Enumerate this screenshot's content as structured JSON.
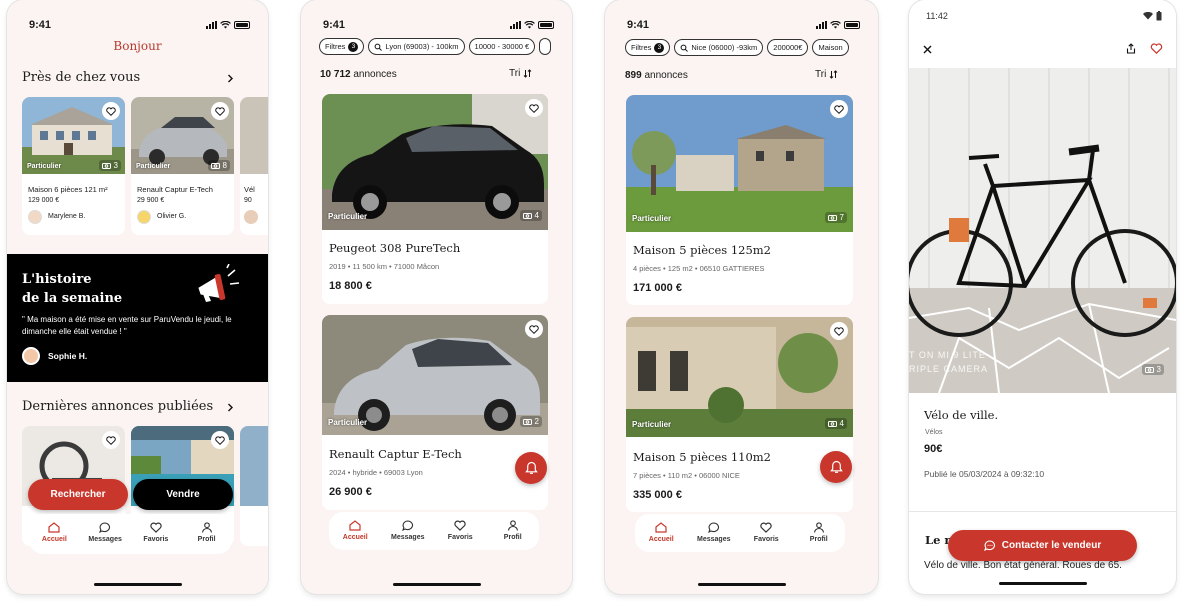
{
  "colors": {
    "accent": "#c9372c",
    "dark": "#111111",
    "bg": "#fbf4f2"
  },
  "screen1": {
    "time": "9:41",
    "greeting": "Bonjour",
    "nearby_title": "Près de chez vous",
    "nearby_cards": [
      {
        "badge": "Particulier",
        "photos": "3",
        "title": "Maison 6 pièces 121 m²",
        "price": "129 000 €",
        "seller": "Marylene B."
      },
      {
        "badge": "Particulier",
        "photos": "8",
        "title": "Renault Captur E-Tech",
        "price": "29 900 €",
        "seller": "Olivier G."
      },
      {
        "title": "Vél",
        "price": "90",
        "seller": ""
      }
    ],
    "story_title_1": "L'histoire",
    "story_title_2": "de la semaine",
    "story_quote": "\" Ma maison a été mise en vente sur ParuVendu le jeudi, le dimanche elle était vendue ! \"",
    "story_author": "Sophie H.",
    "latest_title": "Dernières annonces publiées",
    "search_button": "Rechercher",
    "sell_button": "Vendre",
    "tabs": [
      "Accueil",
      "Messages",
      "Favoris",
      "Profil"
    ]
  },
  "screen2": {
    "time": "9:41",
    "chips": [
      "Filtres",
      "Lyon (69003) - 100km",
      "10000 - 30000 €"
    ],
    "filter_count": "3",
    "count_number": "10 712",
    "count_label": "annonces",
    "sort": "Tri",
    "cards": [
      {
        "badge": "Particulier",
        "photos": "4",
        "title": "Peugeot 308 PureTech",
        "meta1": "2019",
        "meta2": "11 500 km",
        "meta3": "71000 Mâcon",
        "price": "18 800 €"
      },
      {
        "badge": "Particulier",
        "photos": "2",
        "title": "Renault Captur E-Tech",
        "meta1": "2024",
        "meta2": "hybride",
        "meta3": "69003 Lyon",
        "price": "26 900 €"
      }
    ],
    "tabs": [
      "Accueil",
      "Messages",
      "Favoris",
      "Profil"
    ]
  },
  "screen3": {
    "time": "9:41",
    "chips": [
      "Filtres",
      "Nice (06000) -93km",
      "200000€",
      "Maison"
    ],
    "filter_count": "3",
    "count_number": "899",
    "count_label": "annonces",
    "sort": "Tri",
    "cards": [
      {
        "badge": "Particulier",
        "photos": "7",
        "title": "Maison 5 pièces 125m2",
        "meta1": "4 pièces",
        "meta2": "125 m2",
        "meta3": "06510 GATTIERES",
        "price": "171 000 €"
      },
      {
        "badge": "Particulier",
        "photos": "4",
        "title": "Maison 5 pièces 110m2",
        "meta1": "7 pièces",
        "meta2": "110 m2",
        "meta3": "06000 NICE",
        "price": "335 000 €"
      }
    ],
    "tabs": [
      "Accueil",
      "Messages",
      "Favoris",
      "Profil"
    ]
  },
  "screen4": {
    "time": "11:42",
    "photo_text_1": "T ON MI 9 LITE",
    "photo_text_2": "RIPLE CAMERA",
    "photos": "3",
    "title": "Vélo de ville.",
    "category": "Vélos",
    "price": "90€",
    "published": "Publié le 05/03/2024 à 09:32:10",
    "section_title": "Le m",
    "description": "Vélo de ville. Bon état général. Roues de 65.",
    "contact_button": "Contacter le vendeur"
  }
}
